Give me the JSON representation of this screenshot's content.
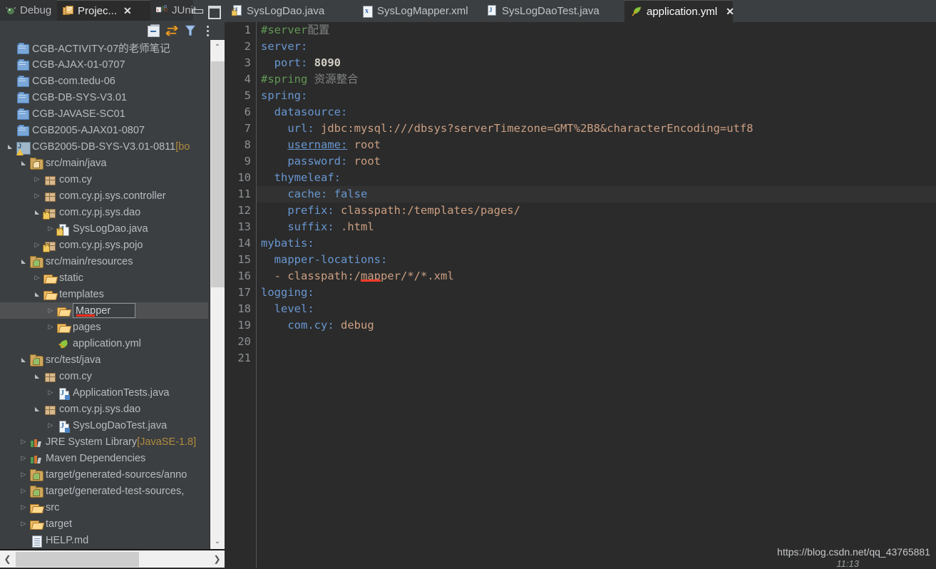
{
  "window": {
    "minimize_label": "—",
    "maximize_label": "▣"
  },
  "view_tabs": [
    {
      "label": "Debug",
      "icon": "debug-bug-icon",
      "active": false,
      "closable": false
    },
    {
      "label": "Projec...",
      "icon": "project-explorer-icon",
      "active": true,
      "closable": true,
      "close_label": "✕"
    },
    {
      "label": "JUnit",
      "icon": "junit-icon",
      "active": false,
      "closable": false
    }
  ],
  "panel_toolbar": {
    "icons": [
      {
        "name": "collapse-all-icon",
        "tooltip": "Collapse All"
      },
      {
        "name": "link-with-editor-icon",
        "tooltip": "Link with Editor"
      },
      {
        "name": "filter-icon",
        "tooltip": "Filters"
      },
      {
        "name": "view-menu-icon",
        "tooltip": "View Menu"
      }
    ]
  },
  "tree": {
    "items": [
      {
        "label": "CGB-ACTIVITY-07的老师笔记",
        "indent": 0,
        "arrow": "none",
        "icon": "blue-folder-icon",
        "selected": false
      },
      {
        "label": "CGB-AJAX-01-0707",
        "indent": 0,
        "arrow": "none",
        "icon": "blue-folder-icon",
        "selected": false
      },
      {
        "label": "CGB-com.tedu-06",
        "indent": 0,
        "arrow": "none",
        "icon": "blue-folder-icon",
        "selected": false
      },
      {
        "label": "CGB-DB-SYS-V3.01",
        "indent": 0,
        "arrow": "none",
        "icon": "blue-folder-icon",
        "selected": false
      },
      {
        "label": "CGB-JAVASE-SC01",
        "indent": 0,
        "arrow": "none",
        "icon": "blue-folder-icon",
        "selected": false
      },
      {
        "label": "CGB2005-AJAX01-0807",
        "indent": 0,
        "arrow": "none",
        "icon": "blue-folder-icon",
        "selected": false
      },
      {
        "label": "CGB2005-DB-SYS-V3.01-0811",
        "sublabel": " [bo",
        "indent": 0,
        "arrow": "open",
        "icon": "java-project-icon",
        "selected": false
      },
      {
        "label": "src/main/java",
        "indent": 1,
        "arrow": "open",
        "icon": "source-folder-icon",
        "selected": false
      },
      {
        "label": "com.cy",
        "indent": 2,
        "arrow": "closed",
        "icon": "package-icon",
        "selected": false
      },
      {
        "label": "com.cy.pj.sys.controller",
        "indent": 2,
        "arrow": "closed",
        "icon": "package-icon",
        "selected": false
      },
      {
        "label": "com.cy.pj.sys.dao",
        "indent": 2,
        "arrow": "open",
        "icon": "package-locked-icon",
        "selected": false
      },
      {
        "label": "SysLogDao.java",
        "indent": 3,
        "arrow": "closed",
        "icon": "java-interface-locked-icon",
        "selected": false
      },
      {
        "label": "com.cy.pj.sys.pojo",
        "indent": 2,
        "arrow": "closed",
        "icon": "package-locked-icon",
        "selected": false
      },
      {
        "label": "src/main/resources",
        "indent": 1,
        "arrow": "open",
        "icon": "resource-folder-icon",
        "selected": false
      },
      {
        "label": "static",
        "indent": 2,
        "arrow": "closed",
        "icon": "open-folder-icon",
        "selected": false
      },
      {
        "label": "templates",
        "indent": 2,
        "arrow": "open",
        "icon": "open-folder-icon",
        "selected": false
      },
      {
        "label": "Mapper",
        "indent": 3,
        "arrow": "closed",
        "icon": "open-folder-icon",
        "selected": true,
        "editing": true
      },
      {
        "label": "pages",
        "indent": 3,
        "arrow": "closed",
        "icon": "open-folder-icon",
        "selected": false
      },
      {
        "label": "application.yml",
        "indent": 3,
        "arrow": "none",
        "icon": "yml-file-icon",
        "selected": false
      },
      {
        "label": "src/test/java",
        "indent": 1,
        "arrow": "open",
        "icon": "test-source-folder-icon",
        "selected": false
      },
      {
        "label": "com.cy",
        "indent": 2,
        "arrow": "open",
        "icon": "package-icon",
        "selected": false
      },
      {
        "label": "ApplicationTests.java",
        "indent": 3,
        "arrow": "closed",
        "icon": "java-test-file-icon",
        "selected": false
      },
      {
        "label": "com.cy.pj.sys.dao",
        "indent": 2,
        "arrow": "open",
        "icon": "package-icon",
        "selected": false
      },
      {
        "label": "SysLogDaoTest.java",
        "indent": 3,
        "arrow": "closed",
        "icon": "java-test-file-icon",
        "selected": false
      },
      {
        "label": "JRE System Library",
        "sublabel": " [JavaSE-1.8]",
        "indent": 1,
        "arrow": "closed",
        "icon": "library-icon",
        "selected": false
      },
      {
        "label": "Maven Dependencies",
        "indent": 1,
        "arrow": "closed",
        "icon": "library-icon",
        "selected": false
      },
      {
        "label": "target/generated-sources/anno",
        "indent": 1,
        "arrow": "closed",
        "icon": "generated-source-folder-icon",
        "selected": false
      },
      {
        "label": "target/generated-test-sources,",
        "indent": 1,
        "arrow": "closed",
        "icon": "generated-source-folder-icon",
        "selected": false
      },
      {
        "label": "src",
        "indent": 1,
        "arrow": "closed",
        "icon": "open-folder-icon",
        "selected": false
      },
      {
        "label": "target",
        "indent": 1,
        "arrow": "closed",
        "icon": "open-folder-icon",
        "selected": false
      },
      {
        "label": "HELP.md",
        "indent": 1,
        "arrow": "none",
        "icon": "markdown-file-icon",
        "selected": false
      }
    ],
    "rename_editor": {
      "value": "Mapper"
    }
  },
  "scrollbars": {
    "vertical": {
      "up_label": "⌃",
      "down_label": "⌄"
    },
    "horizontal": {
      "left_label": "❮",
      "right_label": "❯"
    }
  },
  "editor_tabs": [
    {
      "label": "SysLogDao.java",
      "icon": "java-interface-locked-icon",
      "active": false,
      "closable": false
    },
    {
      "label": "SysLogMapper.xml",
      "icon": "xml-file-icon",
      "active": false,
      "closable": false
    },
    {
      "label": "SysLogDaoTest.java",
      "icon": "java-file-icon",
      "active": false,
      "closable": false
    },
    {
      "label": "application.yml",
      "icon": "yml-file-icon",
      "active": true,
      "closable": true,
      "close_label": "✕"
    }
  ],
  "editor": {
    "highlighted_line": 11,
    "line_numbers": [
      1,
      2,
      3,
      4,
      5,
      6,
      7,
      8,
      9,
      10,
      11,
      12,
      13,
      14,
      15,
      16,
      17,
      18,
      19,
      20,
      21
    ],
    "lines": [
      {
        "n": 1,
        "text": "#server配置"
      },
      {
        "n": 2,
        "text": "server:"
      },
      {
        "n": 3,
        "text": "  port: 8090"
      },
      {
        "n": 4,
        "text": "#spring 资源整合"
      },
      {
        "n": 5,
        "text": "spring:"
      },
      {
        "n": 6,
        "text": "  datasource:"
      },
      {
        "n": 7,
        "text": "    url: jdbc:mysql:///dbsys?serverTimezone=GMT%2B8&characterEncoding=utf8"
      },
      {
        "n": 8,
        "text": "    username: root"
      },
      {
        "n": 9,
        "text": "    password: root"
      },
      {
        "n": 10,
        "text": "  thymeleaf:"
      },
      {
        "n": 11,
        "text": "    cache: false"
      },
      {
        "n": 12,
        "text": "    prefix: classpath:/templates/pages/"
      },
      {
        "n": 13,
        "text": "    suffix: .html"
      },
      {
        "n": 14,
        "text": "mybatis:"
      },
      {
        "n": 15,
        "text": "  mapper-locations:"
      },
      {
        "n": 16,
        "text": "  - classpath:/mapper/*/*.xml"
      },
      {
        "n": 17,
        "text": "logging:"
      },
      {
        "n": 18,
        "text": "  level:"
      },
      {
        "n": 19,
        "text": "    com.cy: debug"
      },
      {
        "n": 20,
        "text": ""
      },
      {
        "n": 21,
        "text": ""
      }
    ],
    "tokens": {
      "l1_comment": "#server",
      "l1_comment_cn": "配置",
      "l2_key": "server:",
      "l3_key": "port:",
      "l3_num": "8090",
      "l4_comment": "#spring",
      "l4_comment_cn": "资源整合",
      "l5_key": "spring:",
      "l6_key": "datasource:",
      "l7_key": "url:",
      "l7_val": "jdbc:mysql:///dbsys?serverTimezone=GMT%2B8&characterEncoding=utf8",
      "l8_key": "username:",
      "l8_val": "root",
      "l9_key": "password:",
      "l9_val": "root",
      "l10_key": "thymeleaf:",
      "l11_key": "cache:",
      "l11_val": "false",
      "l12_key": "prefix:",
      "l12_val": "classpath:/templates/pages/",
      "l13_key": "suffix:",
      "l13_val": ".html",
      "l14_key": "mybatis:",
      "l15_key": "mapper-locations:",
      "l16_dash": "- ",
      "l16_val_a": "classpath:/",
      "l16_val_err": "map",
      "l16_val_b": "per/*/*.xml",
      "l17_key": "logging:",
      "l18_key": "level:",
      "l19_key": "com.cy:",
      "l19_val": "debug"
    }
  },
  "watermark": {
    "url": "https://blog.csdn.net/qq_43765881",
    "time": "11:13"
  },
  "colors": {
    "panel_bg": "#3c3f41",
    "editor_bg": "#2b2b2b",
    "selection_bg": "#4e5052",
    "line_highlight": "#323232",
    "key_blue": "#6897d1",
    "value_orange": "#cc9f82",
    "comment_green": "#629755",
    "error_red": "#ff3b28",
    "gutter_text": "#8d9194",
    "tree_text": "#b6bcc2",
    "sublabel_gold": "#b08b3e"
  }
}
